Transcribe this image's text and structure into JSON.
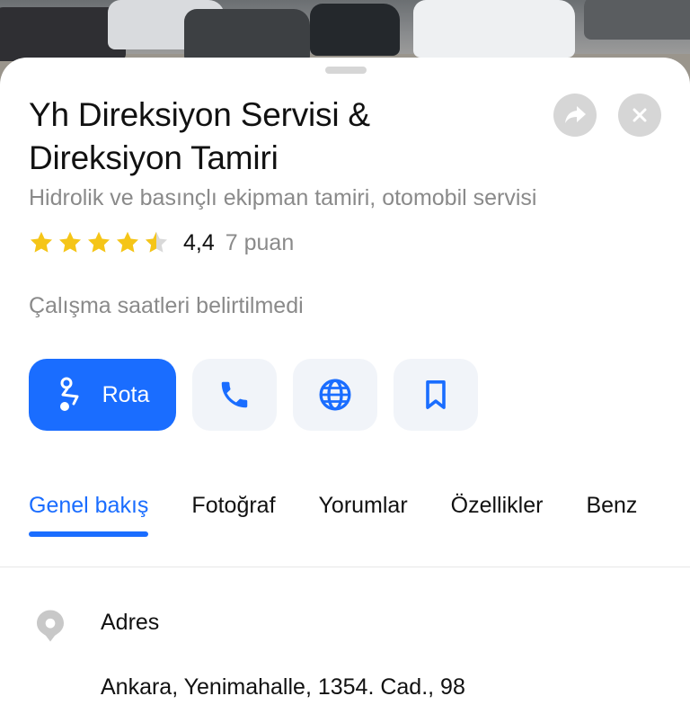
{
  "business": {
    "name_line1": "Yh Direksiyon Servisi &",
    "name_line2": "Direksiyon Tamiri",
    "category": "Hidrolik ve basınçlı ekipman tamiri, otomobil servisi",
    "rating_value": "4,4",
    "rating_count": "7 puan",
    "rating_numeric": 4.4,
    "hours": "Çalışma saatleri belirtilmedi"
  },
  "actions": {
    "route_label": "Rota",
    "icons": [
      "route-icon",
      "phone-icon",
      "globe-icon",
      "bookmark-icon"
    ]
  },
  "tabs": [
    "Genel bakış",
    "Fotoğraf",
    "Yorumlar",
    "Özellikler",
    "Benz"
  ],
  "address": {
    "label": "Adres",
    "value": "Ankara, Yenimahalle, 1354. Cad., 98"
  },
  "colors": {
    "accent": "#1a6dff",
    "star": "#f5c518",
    "muted_text": "#8a8a8a"
  }
}
